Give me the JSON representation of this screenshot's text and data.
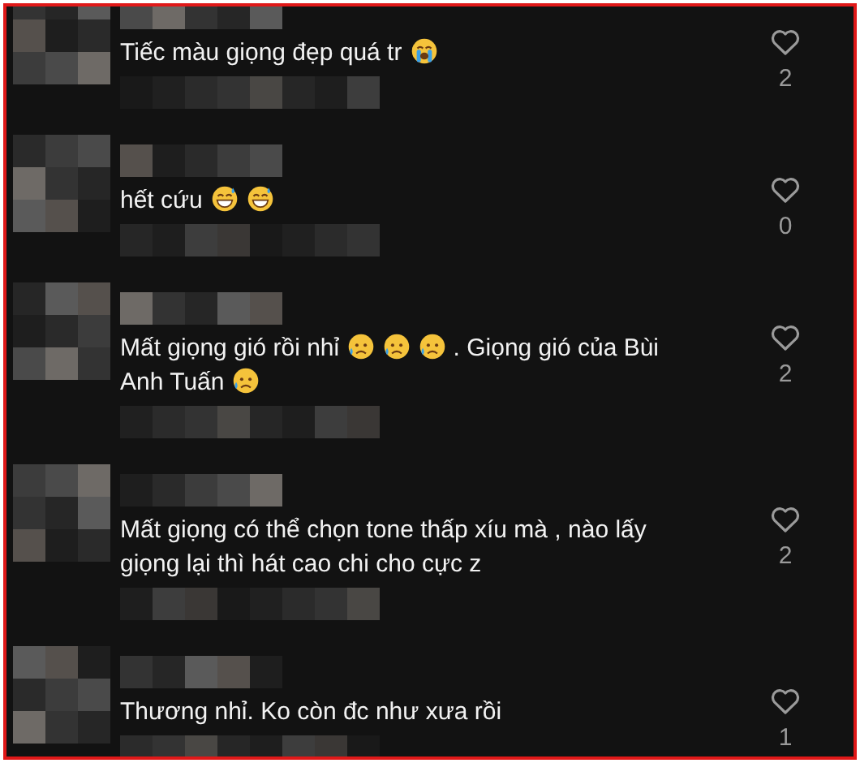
{
  "comments": [
    {
      "parts": [
        {
          "kind": "text",
          "text": "Tiếc màu giọng đẹp quá tr"
        },
        {
          "kind": "crying-face"
        }
      ],
      "likes": "2"
    },
    {
      "parts": [
        {
          "kind": "text",
          "text": "hết cứu"
        },
        {
          "kind": "sweat-grin"
        },
        {
          "kind": "sweat-grin"
        }
      ],
      "likes": "0"
    },
    {
      "parts": [
        {
          "kind": "text",
          "text": "Mất giọng gió rồi nhỉ"
        },
        {
          "kind": "sad-sweat"
        },
        {
          "kind": "sad-sweat"
        },
        {
          "kind": "sad-sweat"
        },
        {
          "kind": "text",
          "text": " . Giọng gió của Bùi Anh Tuấn"
        },
        {
          "kind": "sad-sweat"
        }
      ],
      "likes": "2"
    },
    {
      "parts": [
        {
          "kind": "text",
          "text": "Mất giọng có thể chọn tone thấp xíu mà , nào lấy giọng lại thì hát cao chi cho cực z"
        }
      ],
      "likes": "2"
    },
    {
      "parts": [
        {
          "kind": "text",
          "text": "Thương nhỉ. Ko còn đc như xưa rồi"
        }
      ],
      "likes": "1"
    }
  ]
}
